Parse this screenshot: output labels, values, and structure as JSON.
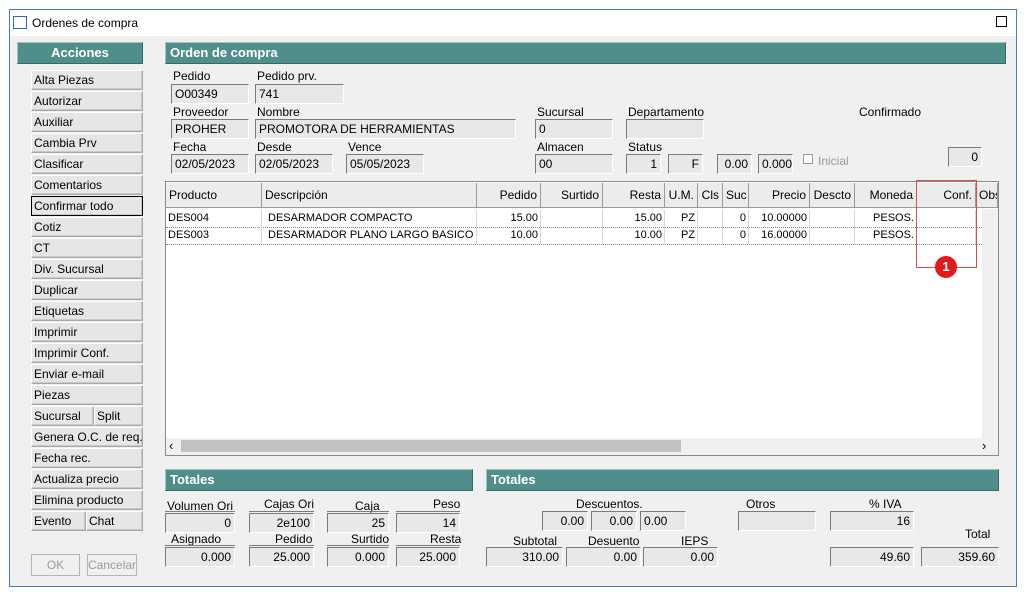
{
  "window": {
    "title": "Ordenes de compra"
  },
  "actions": {
    "header": "Acciones",
    "items": [
      "Alta Piezas",
      "Autorizar",
      "Auxiliar",
      "Cambia Prv",
      "Clasificar",
      "Comentarios",
      "Confirmar todo",
      "Cotiz",
      "CT",
      "Div. Sucursal",
      "Duplicar",
      "Etiquetas",
      "Imprimir",
      "Imprimir Conf.",
      "Enviar e-mail",
      "Piezas"
    ],
    "sucursal": "Sucursal",
    "split": "Split",
    "genera": "Genera O.C. de req.",
    "fecha_rec": "Fecha rec.",
    "actualiza": "Actualiza precio",
    "elimina": "Elimina producto",
    "evento": "Evento",
    "chat": "Chat",
    "ok": "OK",
    "cancelar": "Cancelar"
  },
  "order": {
    "header": "Orden de compra",
    "pedido_label": "Pedido",
    "pedido": "O00349",
    "pedido_prv_label": "Pedido prv.",
    "pedido_prv": "741",
    "proveedor_label": "Proveedor",
    "proveedor": "PROHER",
    "nombre_label": "Nombre",
    "nombre": "PROMOTORA DE HERRAMIENTAS",
    "sucursal_label": "Sucursal",
    "sucursal": "0",
    "departamento_label": "Departamento",
    "departamento": "",
    "confirmado_label": "Confirmado",
    "fecha_label": "Fecha",
    "fecha": "02/05/2023",
    "desde_label": "Desde",
    "desde": "02/05/2023",
    "vence_label": "Vence",
    "vence": "05/05/2023",
    "almacen_label": "Almacen",
    "almacen": "00",
    "status_label": "Status",
    "status_num": "1",
    "status_code": "F",
    "val1": "0.00",
    "val2": "0.000",
    "inicial_label": "Inicial",
    "counter": "0"
  },
  "table": {
    "columns": [
      "Producto",
      "Descripción",
      "Pedido",
      "Surtido",
      "Resta",
      "U.M.",
      "Cls",
      "Suc",
      "Precio",
      "Descto",
      "Moneda",
      "Conf.",
      "Obs."
    ],
    "rows": [
      [
        "DES004",
        "DESARMADOR COMPACTO",
        "15.00",
        "",
        "15.00",
        "PZ",
        "",
        "0",
        "10.00000",
        "",
        "PESOS.",
        "",
        ""
      ],
      [
        "DES003",
        "DESARMADOR PLANO LARGO BASICO",
        "10.00",
        "",
        "10.00",
        "PZ",
        "",
        "0",
        "16.00000",
        "",
        "PESOS.",
        "",
        ""
      ]
    ],
    "scroll_left": "‹",
    "scroll_right": "›"
  },
  "totales_left": {
    "header": "Totales",
    "volumen_label": "Volumen Ori",
    "volumen": "0",
    "cajas_ori_label": "Cajas Ori",
    "cajas_ori": "2e100",
    "caja_label": "Caja",
    "caja": "25",
    "peso_label": "Peso",
    "peso": "14",
    "asignado_label": "Asignado",
    "asignado": "0.000",
    "pedido_label": "Pedido",
    "pedido": "25.000",
    "surtido_label": "Surtido",
    "surtido": "0.000",
    "resta_label": "Resta",
    "resta": "25.000"
  },
  "totales_right": {
    "header": "Totales",
    "descuentos_label": "Descuentos.",
    "desc1": "0.00",
    "desc2": "0.00",
    "desc3": "0.00",
    "otros_label": "Otros",
    "otros": "",
    "iva_label": "% IVA",
    "iva": "16",
    "total_label": "Total",
    "subtotal_label": "Subtotal",
    "subtotal": "310.00",
    "desuento_label": "Desuento",
    "desuento": "0.00",
    "ieps_label": "IEPS",
    "ieps": "0.00",
    "iva_amount": "49.60",
    "total": "359.60"
  },
  "annotation": {
    "badge": "1"
  }
}
